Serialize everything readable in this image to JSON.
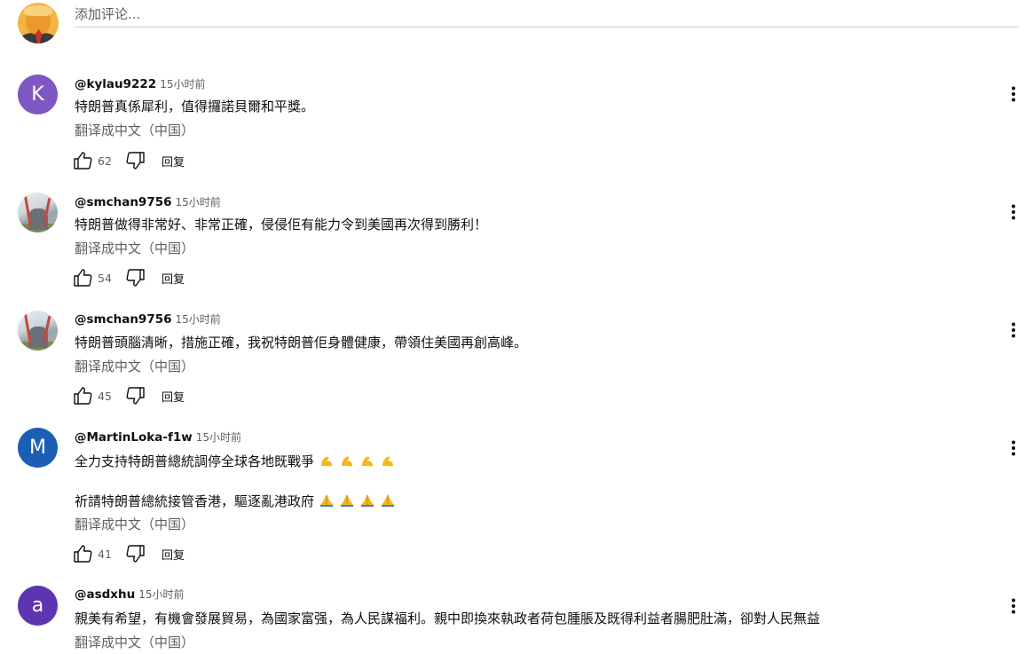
{
  "composer": {
    "placeholder": "添加评论..."
  },
  "comments": [
    {
      "author": "@kylau9222",
      "time": "15小时前",
      "avatar_letter": "K",
      "avatar_color": "#7e57c2",
      "lines": [
        "特朗普真係犀利，值得攞諾貝爾和平獎。"
      ],
      "translate": "翻译成中文（中国）",
      "likes": "62",
      "reply_label": "回复"
    },
    {
      "author": "@smchan9756",
      "time": "15小时前",
      "avatar_letter": "",
      "lines": [
        "特朗普做得非常好、非常正確，侵侵佢有能力令到美國再次得到勝利！"
      ],
      "translate": "翻译成中文（中国）",
      "likes": "54",
      "reply_label": "回复"
    },
    {
      "author": "@smchan9756",
      "time": "15小时前",
      "avatar_letter": "",
      "lines": [
        "特朗普頭腦清晰，措施正確，我祝特朗普佢身體健康，帶領住美國再創高峰。"
      ],
      "translate": "翻译成中文（中国）",
      "likes": "45",
      "reply_label": "回复"
    },
    {
      "author": "@MartinLoka-f1w",
      "time": "15小时前",
      "avatar_letter": "M",
      "avatar_color": "#1a5fb4",
      "lines": [
        "全力支持特朗普總統調停全球各地既戰爭",
        "祈請特朗普總統接管香港，驅逐亂港政府"
      ],
      "line_emojis": [
        "flexed-biceps-emoji",
        "folded-hands-emoji"
      ],
      "translate": "翻译成中文（中国）",
      "likes": "41",
      "reply_label": "回复"
    },
    {
      "author": "@asdxhu",
      "time": "15小时前",
      "avatar_letter": "a",
      "avatar_color": "#5e35b1",
      "lines": [
        "親美有希望，有機會發展貿易，為國家富强，為人民謀福利。親中即換來執政者荷包腫脹及既得利益者腸肥肚滿，卻對人民無益"
      ],
      "translate": "翻译成中文（中国）"
    }
  ]
}
